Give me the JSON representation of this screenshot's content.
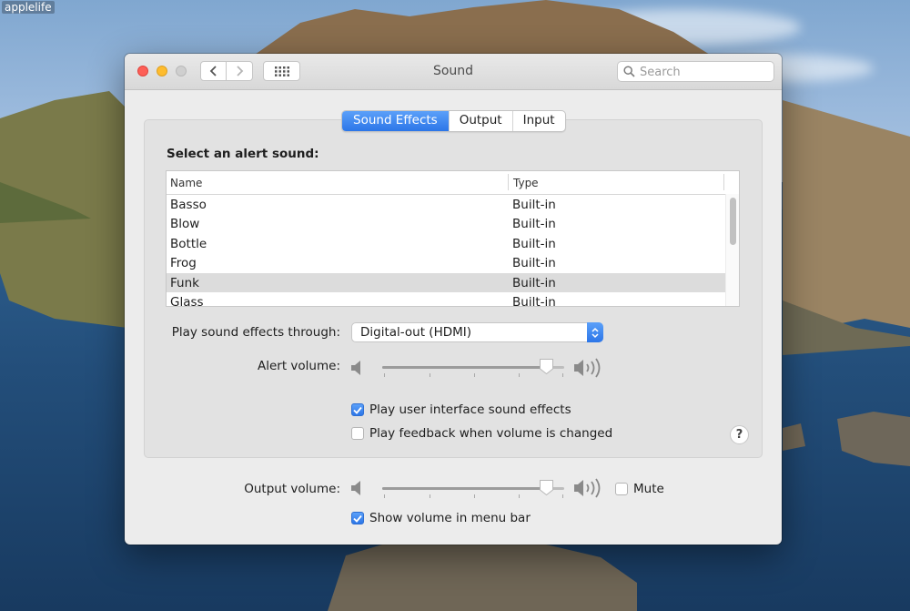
{
  "watermark": "applelife",
  "window": {
    "title": "Sound",
    "search_placeholder": "Search"
  },
  "tabs": [
    {
      "label": "Sound Effects",
      "active": true
    },
    {
      "label": "Output",
      "active": false
    },
    {
      "label": "Input",
      "active": false
    }
  ],
  "sound_effects": {
    "select_label": "Select an alert sound:",
    "columns": [
      "Name",
      "Type"
    ],
    "sounds": [
      {
        "name": "Basso",
        "type": "Built-in",
        "selected": false
      },
      {
        "name": "Blow",
        "type": "Built-in",
        "selected": false
      },
      {
        "name": "Bottle",
        "type": "Built-in",
        "selected": false
      },
      {
        "name": "Frog",
        "type": "Built-in",
        "selected": false
      },
      {
        "name": "Funk",
        "type": "Built-in",
        "selected": true
      },
      {
        "name": "Glass",
        "type": "Built-in",
        "selected": false
      }
    ],
    "play_through_label": "Play sound effects through:",
    "play_through_value": "Digital-out (HDMI)",
    "alert_volume_label": "Alert volume:",
    "alert_volume_level": 0.9,
    "ui_sounds": {
      "label": "Play user interface sound effects",
      "checked": true
    },
    "feedback": {
      "label": "Play feedback when volume is changed",
      "checked": false
    },
    "help": "?"
  },
  "output": {
    "output_volume_label": "Output volume:",
    "output_volume_level": 0.9,
    "mute": {
      "label": "Mute",
      "checked": false
    },
    "menu_bar": {
      "label": "Show volume in menu bar",
      "checked": true
    }
  },
  "colors": {
    "accent": "#2c76e8",
    "close": "#fd5f57",
    "minimize": "#febc2e",
    "zoom": "#cfcfcf"
  }
}
